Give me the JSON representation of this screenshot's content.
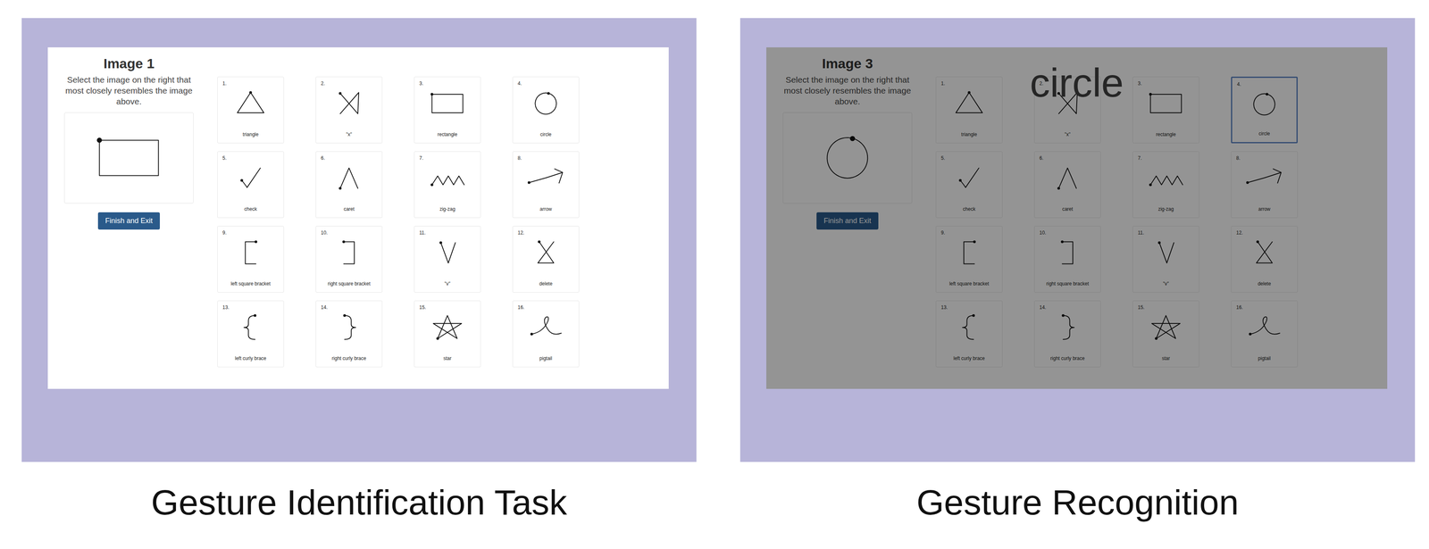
{
  "panels": [
    {
      "screenshot": {
        "title": "Image 1",
        "instruction": "Select the image on the right that most closely resembles the image above.",
        "preview": {
          "kind": "rectangle"
        },
        "button": "Finish and Exit",
        "gestures": [
          {
            "number": "1.",
            "label": "triangle",
            "kind": "triangle",
            "selected": false
          },
          {
            "number": "2.",
            "label": "\"x\"",
            "kind": "x",
            "selected": false
          },
          {
            "number": "3.",
            "label": "rectangle",
            "kind": "rectangle",
            "selected": false
          },
          {
            "number": "4.",
            "label": "circle",
            "kind": "circle",
            "selected": false
          },
          {
            "number": "5.",
            "label": "check",
            "kind": "check",
            "selected": false
          },
          {
            "number": "6.",
            "label": "caret",
            "kind": "caret",
            "selected": false
          },
          {
            "number": "7.",
            "label": "zig-zag",
            "kind": "zigzag",
            "selected": false
          },
          {
            "number": "8.",
            "label": "arrow",
            "kind": "arrow",
            "selected": false
          },
          {
            "number": "9.",
            "label": "left square bracket",
            "kind": "lsquare",
            "selected": false
          },
          {
            "number": "10.",
            "label": "right square bracket",
            "kind": "rsquare",
            "selected": false
          },
          {
            "number": "11.",
            "label": "\"v\"",
            "kind": "v",
            "selected": false
          },
          {
            "number": "12.",
            "label": "delete",
            "kind": "delete",
            "selected": false
          },
          {
            "number": "13.",
            "label": "left curly brace",
            "kind": "lcurly",
            "selected": false
          },
          {
            "number": "14.",
            "label": "right curly brace",
            "kind": "rcurly",
            "selected": false
          },
          {
            "number": "15.",
            "label": "star",
            "kind": "star",
            "selected": false
          },
          {
            "number": "16.",
            "label": "pigtail",
            "kind": "pigtail",
            "selected": false
          }
        ]
      },
      "caption": "Gesture Identification Task"
    },
    {
      "screenshot": {
        "title": "Image 3",
        "instruction": "Select the image on the right that most closely resembles the image above.",
        "preview": {
          "kind": "circle"
        },
        "button": "Finish and Exit",
        "overlay": {
          "text": "circle"
        },
        "gestures": [
          {
            "number": "1.",
            "label": "triangle",
            "kind": "triangle",
            "selected": false
          },
          {
            "number": "2.",
            "label": "\"x\"",
            "kind": "x",
            "selected": false
          },
          {
            "number": "3.",
            "label": "rectangle",
            "kind": "rectangle",
            "selected": false
          },
          {
            "number": "4.",
            "label": "circle",
            "kind": "circle",
            "selected": true
          },
          {
            "number": "5.",
            "label": "check",
            "kind": "check",
            "selected": false
          },
          {
            "number": "6.",
            "label": "caret",
            "kind": "caret",
            "selected": false
          },
          {
            "number": "7.",
            "label": "zig-zag",
            "kind": "zigzag",
            "selected": false
          },
          {
            "number": "8.",
            "label": "arrow",
            "kind": "arrow",
            "selected": false
          },
          {
            "number": "9.",
            "label": "left square bracket",
            "kind": "lsquare",
            "selected": false
          },
          {
            "number": "10.",
            "label": "right square bracket",
            "kind": "rsquare",
            "selected": false
          },
          {
            "number": "11.",
            "label": "\"v\"",
            "kind": "v",
            "selected": false
          },
          {
            "number": "12.",
            "label": "delete",
            "kind": "delete",
            "selected": false
          },
          {
            "number": "13.",
            "label": "left curly brace",
            "kind": "lcurly",
            "selected": false
          },
          {
            "number": "14.",
            "label": "right curly brace",
            "kind": "rcurly",
            "selected": false
          },
          {
            "number": "15.",
            "label": "star",
            "kind": "star",
            "selected": false
          },
          {
            "number": "16.",
            "label": "pigtail",
            "kind": "pigtail",
            "selected": false
          }
        ]
      },
      "caption": "Gesture Recognition"
    }
  ]
}
